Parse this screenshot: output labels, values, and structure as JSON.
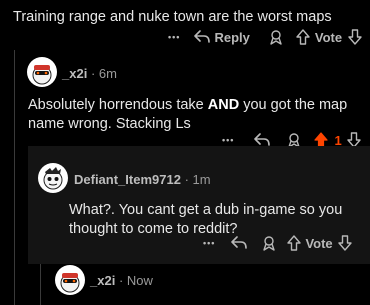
{
  "top_comment": {
    "text": "Training range and nuke town are the worst maps",
    "actions": {
      "more": "•••",
      "reply_label": "Reply",
      "vote_label": "Vote"
    }
  },
  "reply1": {
    "username": "_x2i",
    "time": "6m",
    "text_before": "Absolutely horrendous take ",
    "text_bold": "AND",
    "text_after": " you got the map name wrong. Stacking Ls",
    "actions": {
      "more": "•••",
      "vote_count": "1"
    }
  },
  "reply2": {
    "username": "Defiant_Item9712",
    "time": "1m",
    "text": "What?. You cant get a dub in-game so you thought to come to reddit?",
    "actions": {
      "more": "•••",
      "vote_label": "Vote"
    }
  },
  "reply3": {
    "username": "_x2i",
    "time": "Now"
  },
  "colors": {
    "upvote_active": "#ff4500",
    "background": "#000000",
    "highlight": "#141414"
  }
}
